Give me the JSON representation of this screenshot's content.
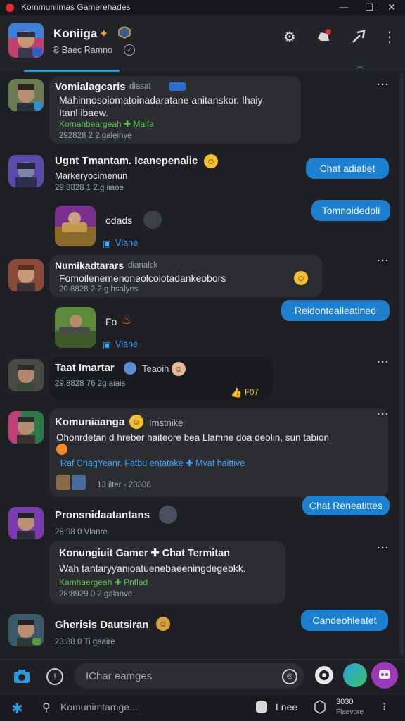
{
  "window": {
    "title": "Kommuniimas Gamerehades",
    "minimize": "—",
    "maximize": "☐",
    "close": "✕"
  },
  "header": {
    "name": "Koniiga",
    "subtitle": "Ƨ Baec Ramno",
    "icons": [
      "gear-icon",
      "notification-icon",
      "share-icon",
      "more-icon"
    ]
  },
  "messages": [
    {
      "name": "Vomialagcaris",
      "tag": "diasat",
      "text1": "Mahinnosoiomatoinadaratane anitanskor. Ihaiy",
      "text2": "Itanl ibaew.",
      "green": "Komanbeargeah  ✚ Malfa",
      "meta": "292828   2  2.galeinve"
    },
    {
      "name": "Ugnt Tmantam. Icanepenalic",
      "sub": "Markeryocimenun",
      "meta": "29:8828   1  2.g iiaoe"
    },
    {
      "name": "odads",
      "meta": "Vlane"
    },
    {
      "name": "Numikadtarars",
      "tag": "dianalck",
      "text1": "Fomoilenemenoneolcoiotadankeobors",
      "meta": "20.8828   2  2.g hsalyes"
    },
    {
      "name": "Fo",
      "meta": "Vlane"
    },
    {
      "name": "Taat Imartar",
      "tag": "Teaoih",
      "meta": "29:8828   76  2g aiais",
      "reaction": "F07"
    },
    {
      "name": "Komuniaanga",
      "tag": "Imstnike",
      "text1": "Ohonrdetan d hreber haiteore bea Llamne doa deolin, sun tabion",
      "blue": "Raf ChagYeanr. Fatbu entatake  ✚ Mvat haittive",
      "meta": "13 ilter - 23306"
    },
    {
      "name": "Pronsnidaatantans",
      "meta": "28:98   0   Vlanre"
    },
    {
      "name": "Konungiuit Gamer  ✚ Chat Termitan",
      "text1": "Wah tantaryyanioatuenebaeeningdegebkk.",
      "green": "Kamhaergeah  ✚ Pntlad",
      "meta": "28:8929   0  2 galanve"
    },
    {
      "name": "Gherisis Dautsiran",
      "meta": "23:88   0   Ti gaaire"
    }
  ],
  "outgoing": [
    "Chat adiatiet",
    "Tomnoidedoli",
    "Reidontealleatined",
    "Chat Reneatittes",
    "Candeohleatet"
  ],
  "composer": {
    "placeholder": "IChar eamges"
  },
  "bottombar": {
    "search_label": "Komunimtamge...",
    "lnee_label": "Lnee",
    "count": "3030",
    "sublabel": "Flaevore"
  },
  "colors": {
    "accent": "#1d7fd0",
    "background": "#1e2023",
    "bubble": "#2b2d31",
    "green": "#58c454",
    "blue_text": "#3ea6ff"
  }
}
